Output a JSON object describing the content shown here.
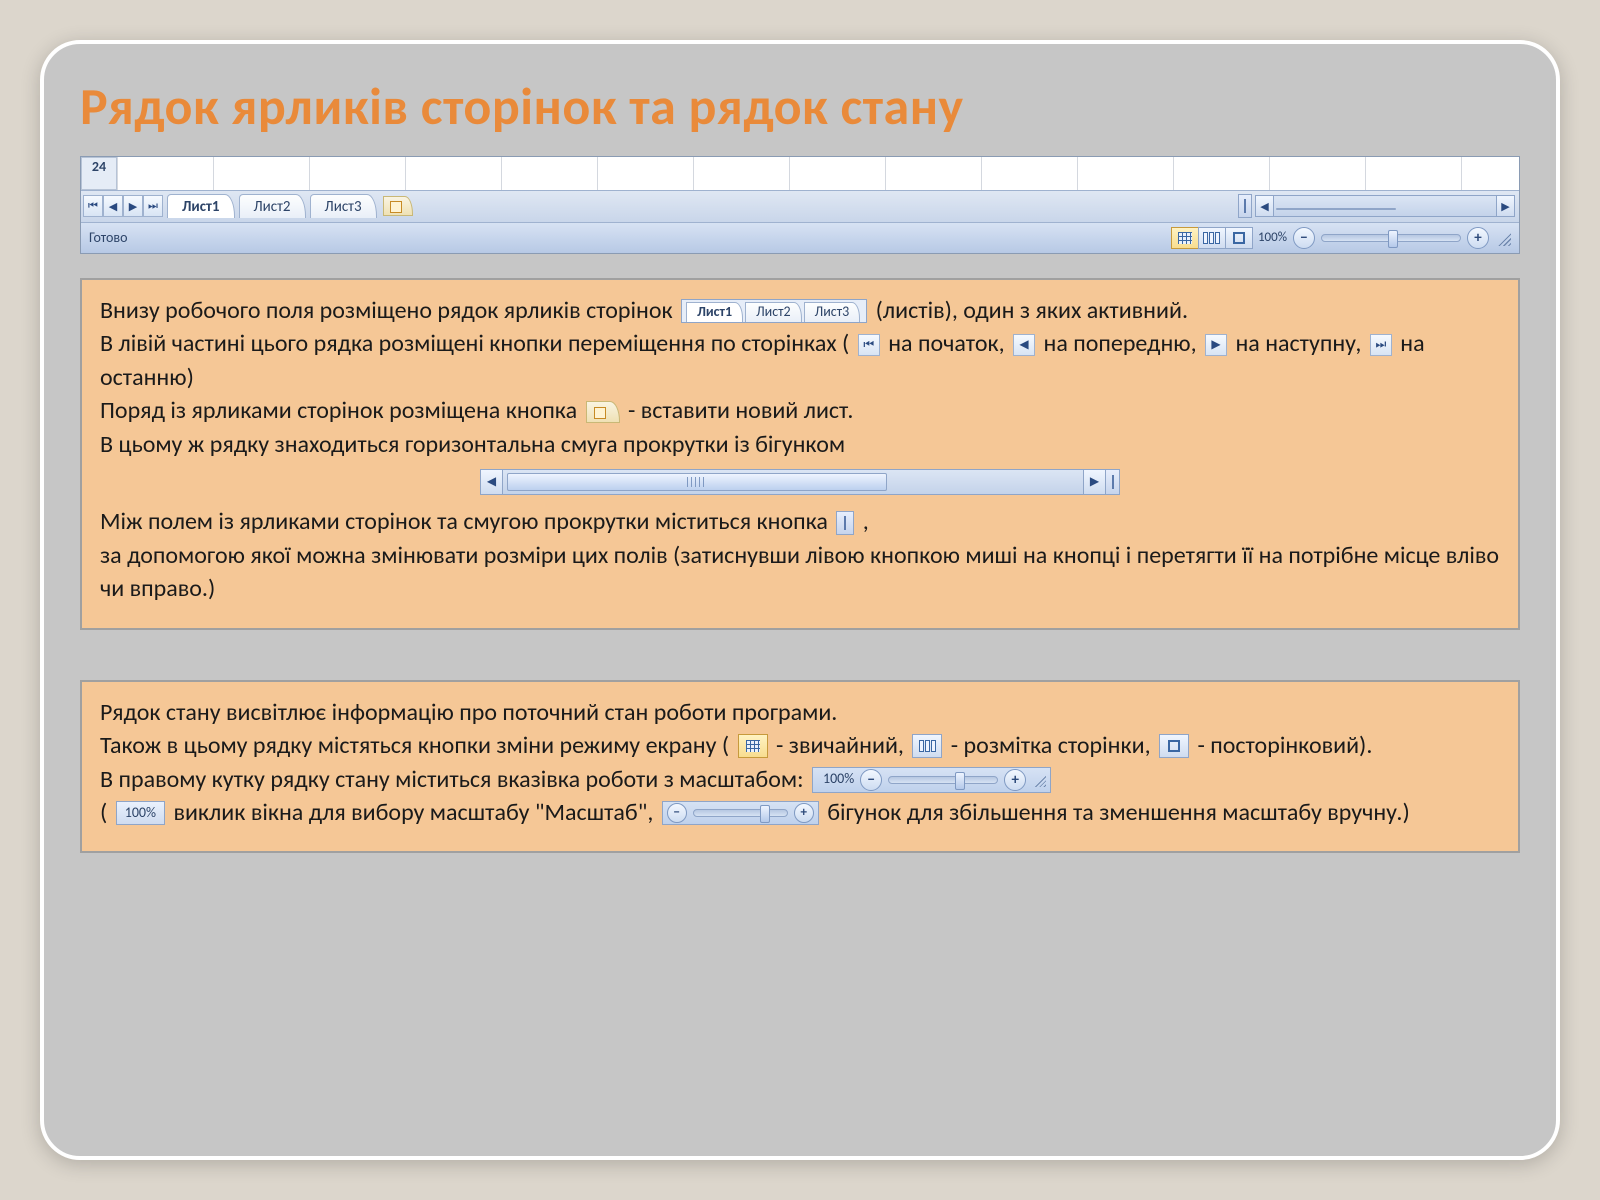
{
  "title": "Рядок ярликів сторінок та рядок стану",
  "excel": {
    "row_number": "24",
    "tabs": [
      "Лист1",
      "Лист2",
      "Лист3"
    ],
    "status_ready": "Готово",
    "zoom_percent": "100%"
  },
  "panel1": {
    "p1a": "Внизу робочого поля розміщено рядок ярликів сторінок",
    "p1b": "(листів), один з яких активний.",
    "p2a": "В лівій частині цього рядка розміщені кнопки переміщення по сторінках (",
    "p2b": "  на початок,",
    "p2c": "  на попередню,",
    "p2d": " на наступну,",
    "p2e": "  на останню)",
    "p3a": "Поряд із ярликами сторінок розміщена кнопка",
    "p3b": "- вставити новий лист.",
    "p4": "В цьому ж рядку знаходиться горизонтальна смуга прокрутки із бігунком",
    "p5a": "Між полем із ярликами сторінок та смугою прокрутки міститься кнопка",
    "p5b": ",",
    "p6": "за допомогою якої можна змінювати розміри цих полів (затиснувши лівою кнопкою миші на кнопці і перетягти її на потрібне місце вліво чи вправо.)"
  },
  "panel2": {
    "p1": "Рядок стану висвітлює інформацію про поточний стан роботи програми.",
    "p2a": "Також в цьому рядку містяться кнопки зміни режиму екрану (",
    "p2b": " - звичайний,",
    "p2c": " - розмітка сторінки,",
    "p2d": " - посторінковий).",
    "p3a": "В правому кутку рядку стану міститься  вказівка роботи з масштабом:",
    "p4a": "(",
    "p4b": "виклик вікна для вибору масштабу \"Масштаб\",",
    "p4c": " бігунок для збільшення та зменшення масштабу вручну.)",
    "zoom_percent_small": "100%"
  }
}
